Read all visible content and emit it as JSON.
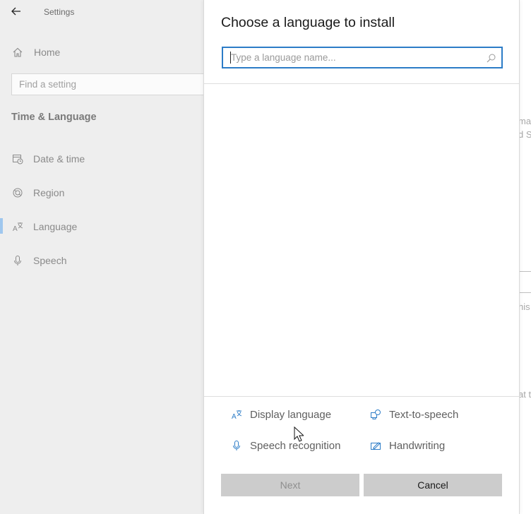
{
  "settings": {
    "app_title": "Settings",
    "home_label": "Home",
    "search_placeholder": "Find a setting",
    "section_title": "Time & Language",
    "nav_items": [
      {
        "label": "Date & time",
        "icon": "calendar-clock-icon"
      },
      {
        "label": "Region",
        "icon": "globe-icon"
      },
      {
        "label": "Language",
        "icon": "language-icon",
        "selected": true
      },
      {
        "label": "Speech",
        "icon": "microphone-icon"
      }
    ],
    "peek": {
      "line1": "ma",
      "line2": "d S",
      "line3": "his",
      "line4": "at t"
    }
  },
  "dialog": {
    "title": "Choose a language to install",
    "search_placeholder": "Type a language name...",
    "search_value": "",
    "features": [
      {
        "label": "Display language",
        "icon": "display-language-icon"
      },
      {
        "label": "Text-to-speech",
        "icon": "text-to-speech-icon"
      },
      {
        "label": "Speech recognition",
        "icon": "microphone-icon"
      },
      {
        "label": "Handwriting",
        "icon": "handwriting-icon"
      }
    ],
    "next_label": "Next",
    "cancel_label": "Cancel",
    "next_enabled": false
  },
  "colors": {
    "accent": "#2c7cc7",
    "selection_bar": "#9fc7ee",
    "button_bg": "#cccccc",
    "sidebar_bg": "#eeeeee"
  }
}
